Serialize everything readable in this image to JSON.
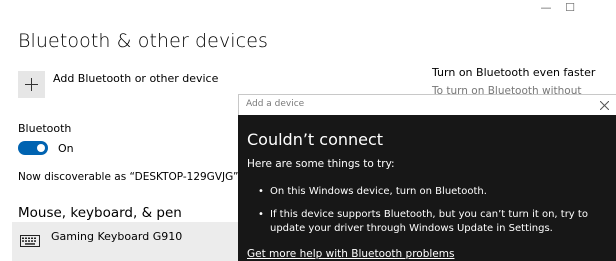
{
  "window": {
    "controls": {
      "minimize": "—",
      "maximize": "☐"
    }
  },
  "page": {
    "title": "Bluetooth & other devices"
  },
  "add_device": {
    "label": "Add Bluetooth or other device"
  },
  "bluetooth": {
    "label": "Bluetooth",
    "toggle_state": "On",
    "discoverable_text": "Now discoverable as “DESKTOP-129GVJG”"
  },
  "section": {
    "title": "Mouse, keyboard, & pen"
  },
  "devices": [
    {
      "name": "Gaming Keyboard G910",
      "icon": "keyboard-icon"
    }
  ],
  "right_panel": {
    "heading": "Turn on Bluetooth even faster",
    "subtext": "To turn on Bluetooth without"
  },
  "dialog": {
    "title": "Add a device",
    "heading": "Couldn’t connect",
    "intro": "Here are some things to try:",
    "tips": [
      "On this Windows device, turn on Bluetooth.",
      "If this device supports Bluetooth, but you can’t turn it on, try to update your driver through Windows Update in Settings."
    ],
    "help_link": "Get more help with Bluetooth problems"
  },
  "colors": {
    "accent": "#0063b1",
    "dialog_bg": "#171717",
    "device_row_bg": "#ececec"
  }
}
